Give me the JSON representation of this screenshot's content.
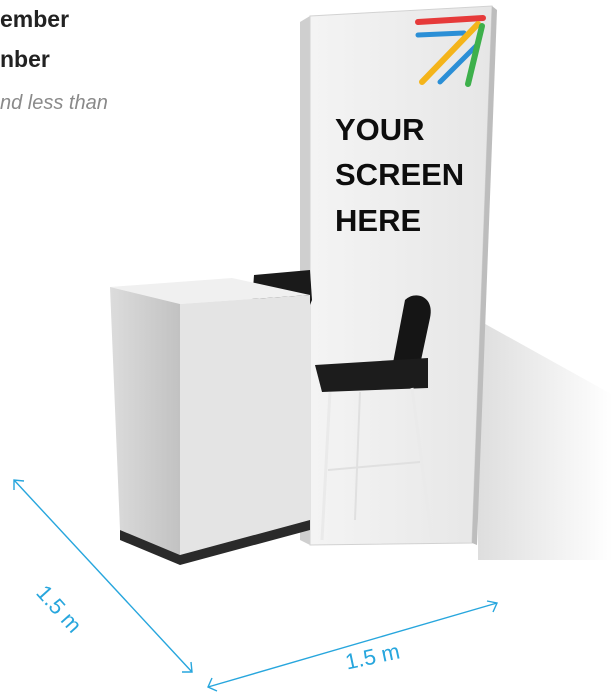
{
  "intro": {
    "line1": "ember",
    "line2": "nber",
    "line3": "nd less than"
  },
  "panel": {
    "line1": "YOUR",
    "line2": "SCREEN",
    "line3": "HERE"
  },
  "dimensions": {
    "depth_label": "1.5 m",
    "width_label": "1.5 m"
  },
  "colors": {
    "dimension": "#27a6dd",
    "logo_red": "#e63a3a",
    "logo_blue": "#2b8fd6",
    "logo_yellow": "#f4b41a",
    "logo_green": "#3db04b"
  }
}
